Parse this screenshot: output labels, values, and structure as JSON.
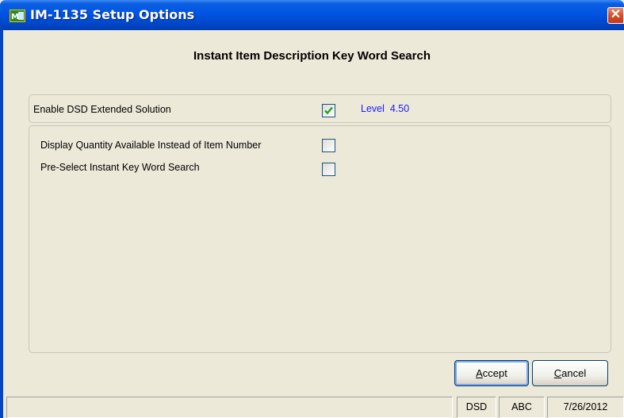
{
  "window": {
    "title": "IM-1135 Setup Options",
    "close_glyph": "✕"
  },
  "heading": "Instant Item Description Key Word Search",
  "options": {
    "enable_dsd": {
      "label": "Enable DSD Extended Solution",
      "checked": true,
      "level": "Level  4.50"
    },
    "display_qty": {
      "label": "Display Quantity Available Instead of Item Number",
      "checked": false
    },
    "preselect": {
      "label": "Pre-Select Instant Key Word Search",
      "checked": false
    }
  },
  "buttons": {
    "accept": {
      "label": "Accept",
      "mnemonic": "A",
      "rest": "ccept"
    },
    "cancel": {
      "label": "Cancel",
      "mnemonic": "C",
      "rest": "ancel"
    }
  },
  "statusbar": {
    "company_code": "DSD",
    "module": "ABC",
    "date": "7/26/2012"
  },
  "colors": {
    "title_bar": "#0054e3",
    "level_text": "#1a1aff",
    "check": "#21a121"
  },
  "icons": {
    "app": "mas90-app-icon",
    "checkmark": "checkmark-icon"
  }
}
